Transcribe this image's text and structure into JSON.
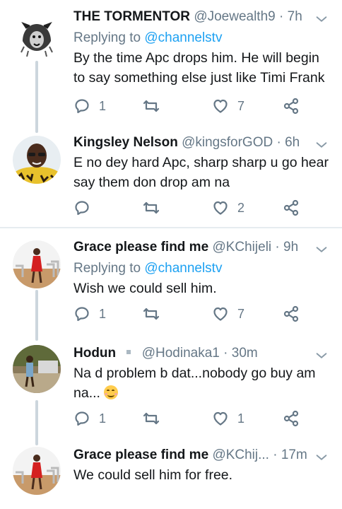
{
  "tweets": [
    {
      "name": "THE TORMENTOR",
      "handle": "@Joewealth9",
      "time": "7h",
      "replying_prefix": "Replying to ",
      "replying_to": "@channelstv",
      "text": "By the time Apc drops him. He will begin to say something else just like Timi Frank",
      "replies": "1",
      "retweets": "",
      "likes": "7",
      "avatar": "lion-avatar"
    },
    {
      "name": "Kingsley Nelson",
      "handle": "@kingsforGOD",
      "time": "6h",
      "text": "E no dey hard Apc, sharp sharp u go hear say them don drop am na",
      "replies": "",
      "retweets": "",
      "likes": "2",
      "avatar": "man-avatar"
    },
    {
      "name": "Grace please find me",
      "handle": "@KChijeli",
      "time": "9h",
      "replying_prefix": "Replying to ",
      "replying_to": "@channelstv",
      "text": "Wish we could sell him.",
      "replies": "1",
      "retweets": "",
      "likes": "7",
      "avatar": "woman-red-dress-avatar"
    },
    {
      "name": "Hodun",
      "handle": "@Hodinaka1",
      "time": "30m",
      "text": "Na d problem b dat...nobody go buy am na...",
      "emoji": "smiling-face-emoji",
      "replies": "1",
      "retweets": "",
      "likes": "1",
      "avatar": "person-outdoor-avatar"
    },
    {
      "name": "Grace please find me",
      "handle": "@KChij...",
      "time": "17m",
      "text": "We could sell him for free.",
      "avatar": "woman-red-dress-avatar"
    }
  ],
  "separator": "·",
  "colors": {
    "accent": "#1da1f2",
    "muted": "#657786",
    "text": "#14171a",
    "line": "#ccd6dd"
  }
}
